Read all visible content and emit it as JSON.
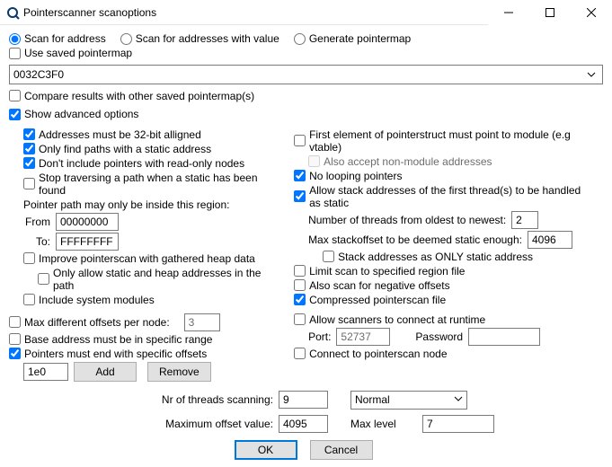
{
  "window": {
    "title": "Pointerscanner scanoptions",
    "minimize_icon": "minimize",
    "maximize_icon": "maximize",
    "close_icon": "close"
  },
  "radios": {
    "scan_for_address": "Scan for address",
    "scan_for_values": "Scan for addresses with value",
    "generate_map": "Generate pointermap"
  },
  "use_saved_map": "Use saved pointermap",
  "address_value": "0032C3F0",
  "compare_saved": "Compare results with other saved pointermap(s)",
  "show_advanced": "Show advanced options",
  "left": {
    "alligned32": "Addresses must be 32-bit alligned",
    "static_paths": "Only find paths with a static address",
    "no_readonly": "Don't include pointers with read-only nodes",
    "stop_static": "Stop traversing a path when a static has been found",
    "region_label": "Pointer path may only be inside this region:",
    "from_label": "From",
    "from_value": "00000000",
    "to_label": "To:",
    "to_value": "FFFFFFFF",
    "improve_heap": "Improve pointerscan with gathered heap data",
    "only_static_heap": "Only allow static and heap addresses in the path",
    "include_sysmods": "Include system modules"
  },
  "right": {
    "first_elem_module": "First element of pointerstruct must point to module (e.g vtable)",
    "accept_nonmodule": "Also accept non-module addresses",
    "no_looping": "No looping pointers",
    "allow_stack": "Allow stack addresses of the first thread(s) to be handled as static",
    "threads_label": "Number of threads from oldest to newest:",
    "threads_value": "2",
    "stackoffset_label": "Max stackoffset to be deemed static enough:",
    "stackoffset_value": "4096",
    "stack_only_static": "Stack addresses as ONLY static address",
    "limit_region_file": "Limit scan to specified region file",
    "scan_negative": "Also scan for negative offsets",
    "compressed_file": "Compressed pointerscan file"
  },
  "mid": {
    "max_diff_offsets": "Max different offsets per node:",
    "max_diff_value": "3",
    "base_range": "Base address must be in specific range",
    "end_specific": "Pointers must end with specific offsets",
    "offset_value": "1e0",
    "add": "Add",
    "remove": "Remove",
    "allow_runtime": "Allow scanners to connect at runtime",
    "port_label": "Port:",
    "port_value": "52737",
    "password_label": "Password",
    "password_value": "",
    "connect_node": "Connect to pointerscan node"
  },
  "bottom": {
    "threads_label": "Nr of threads scanning:",
    "threads_value": "9",
    "priority_value": "Normal",
    "max_offset_label": "Maximum offset value:",
    "max_offset_value": "4095",
    "max_level_label": "Max level",
    "max_level_value": "7"
  },
  "buttons": {
    "ok": "OK",
    "cancel": "Cancel"
  }
}
